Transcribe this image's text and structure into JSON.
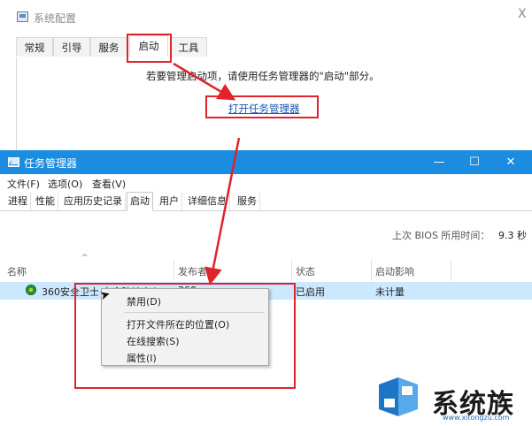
{
  "msconfig": {
    "title": "系统配置",
    "close_glyph": "X",
    "tabs": [
      {
        "label": "常规"
      },
      {
        "label": "引导"
      },
      {
        "label": "服务"
      },
      {
        "label": "启动",
        "active": true
      },
      {
        "label": "工具"
      }
    ],
    "message": "若要管理启动项，请使用任务管理器的\"启动\"部分。",
    "open_taskmgr_link": "打开任务管理器"
  },
  "taskmgr": {
    "title": "任务管理器",
    "window_buttons": {
      "minimize": "—",
      "maximize": "☐",
      "close": "✕"
    },
    "menu": [
      "文件(F)",
      "选项(O)",
      "查看(V)"
    ],
    "tabs": [
      "进程",
      "性能",
      "应用历史记录",
      "启动",
      "用户",
      "详细信息",
      "服务"
    ],
    "active_tab": "启动",
    "bios_label": "上次 BIOS 所用时间：",
    "bios_value": "9.3 秒",
    "sort_arrow": "^",
    "columns": [
      "名称",
      "发布者",
      "状态",
      "启动影响"
    ],
    "rows": [
      {
        "name": "360安全卫士 安全防护中心",
        "publisher": "360",
        "status": "已启用",
        "impact": "未计量",
        "icon": "360-shield-icon"
      }
    ],
    "context_menu": [
      "禁用(D)",
      "打开文件所在的位置(O)",
      "在线搜索(S)",
      "属性(I)"
    ]
  },
  "watermark": {
    "brand": "系统族",
    "url": "www.xitongzu.com"
  },
  "colors": {
    "titlebar_blue": "#1b8ce0",
    "annotation_red": "#e0242c",
    "selected_row": "#cce8ff",
    "link_blue": "#1a56b4"
  }
}
